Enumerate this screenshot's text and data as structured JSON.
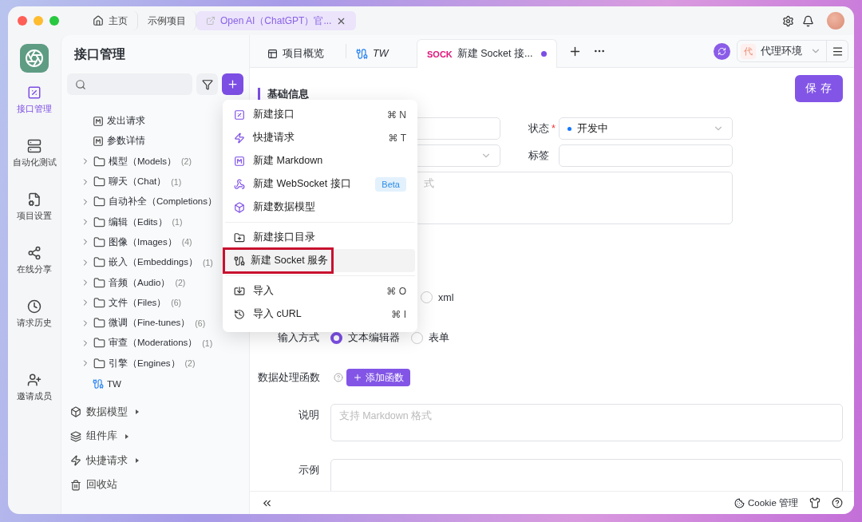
{
  "window": {
    "tabs": [
      {
        "label": "主页",
        "kind": "home",
        "selected": false
      },
      {
        "label": "示例项目",
        "kind": "plain",
        "selected": false
      },
      {
        "label": "Open AI（ChatGPT）官...",
        "kind": "project",
        "selected": true
      }
    ]
  },
  "rail": {
    "items": [
      {
        "label": "接口管理",
        "kind": "api",
        "selected": true
      },
      {
        "label": "自动化测试",
        "kind": "test",
        "selected": false
      },
      {
        "label": "项目设置",
        "kind": "settings",
        "selected": false
      },
      {
        "label": "在线分享",
        "kind": "share",
        "selected": false
      },
      {
        "label": "请求历史",
        "kind": "history",
        "selected": false
      },
      {
        "label": "邀请成员",
        "kind": "invite",
        "selected": false
      }
    ]
  },
  "sidebar": {
    "title": "接口管理",
    "tree": [
      {
        "label": "发出请求",
        "kind": "doc"
      },
      {
        "label": "参数详情",
        "kind": "doc"
      },
      {
        "label": "模型（Models）",
        "count": "(2)",
        "kind": "folder",
        "expanded": false
      },
      {
        "label": "聊天（Chat）",
        "count": "(1)",
        "kind": "folder",
        "expanded": false
      },
      {
        "label": "自动补全（Completions）",
        "kind": "folder",
        "expanded": false
      },
      {
        "label": "编辑（Edits）",
        "count": "(1)",
        "kind": "folder",
        "expanded": false
      },
      {
        "label": "图像（Images）",
        "count": "(4)",
        "kind": "folder",
        "expanded": false
      },
      {
        "label": "嵌入（Embeddings）",
        "count": "(1)",
        "kind": "folder",
        "expanded": false
      },
      {
        "label": "音频（Audio）",
        "count": "(2)",
        "kind": "folder",
        "expanded": false
      },
      {
        "label": "文件（Files）",
        "count": "(6)",
        "kind": "folder",
        "expanded": false
      },
      {
        "label": "微调（Fine-tunes）",
        "count": "(6)",
        "kind": "folder",
        "expanded": false
      },
      {
        "label": "审查（Moderations）",
        "count": "(1)",
        "kind": "folder",
        "expanded": false
      },
      {
        "label": "引擎（Engines）",
        "count": "(2)",
        "kind": "folder",
        "expanded": false
      },
      {
        "label": "TW",
        "kind": "socket"
      }
    ],
    "sections": [
      {
        "label": "数据模型",
        "kind": "model",
        "expandable": true
      },
      {
        "label": "组件库",
        "kind": "library",
        "expandable": true
      },
      {
        "label": "快捷请求",
        "kind": "quick",
        "expandable": true
      },
      {
        "label": "回收站",
        "kind": "trash",
        "expandable": false
      }
    ]
  },
  "doc_tabs": [
    {
      "label": "项目概览",
      "kind": "overview",
      "selected": false
    },
    {
      "label": "TW",
      "kind": "socket",
      "selected": false
    },
    {
      "badge": "SOCK",
      "label": "新建 Socket 接...",
      "kind": "socket-new",
      "selected": true,
      "unsaved": true
    }
  ],
  "environment": {
    "badge": "代",
    "label": "代理环境"
  },
  "save_button": "保 存",
  "section_title": "基础信息",
  "form": {
    "status": {
      "label": "状态",
      "required": true,
      "required_mark": "*",
      "value": "开发中"
    },
    "tags": {
      "label": "标签"
    },
    "description_fragment": "式",
    "format_options": [
      {
        "label": "xml",
        "selected": false
      }
    ],
    "input_mode": {
      "label": "输入方式",
      "options": [
        {
          "label": "文本编辑器",
          "selected": true
        },
        {
          "label": "表单",
          "selected": false
        }
      ]
    },
    "processor": {
      "label": "数据处理函数",
      "button": "添加函数"
    },
    "notes": {
      "label": "说明",
      "placeholder": "支持 Markdown 格式"
    },
    "example": {
      "label": "示例"
    }
  },
  "footer": {
    "cookie": "Cookie 管理"
  },
  "menu": {
    "groups": [
      [
        {
          "label": "新建接口",
          "kind": "api",
          "shortcut": "⌘ N",
          "highlighted": false
        },
        {
          "label": "快捷请求",
          "kind": "quick",
          "shortcut": "⌘ T",
          "highlighted": false
        },
        {
          "label": "新建 Markdown",
          "kind": "markdown",
          "highlighted": false
        },
        {
          "label": "新建 WebSocket 接口",
          "kind": "websocket",
          "badge": "Beta",
          "highlighted": false
        },
        {
          "label": "新建数据模型",
          "kind": "model",
          "highlighted": false
        }
      ],
      [
        {
          "label": "新建接口目录",
          "kind": "folder",
          "highlighted": false
        },
        {
          "label": "新建 Socket 服务",
          "kind": "socket",
          "highlighted": true
        }
      ],
      [
        {
          "label": "导入",
          "kind": "import",
          "shortcut": "⌘ O",
          "highlighted": false
        },
        {
          "label": "导入 cURL",
          "kind": "curl",
          "shortcut": "⌘ I",
          "highlighted": false
        }
      ]
    ]
  }
}
